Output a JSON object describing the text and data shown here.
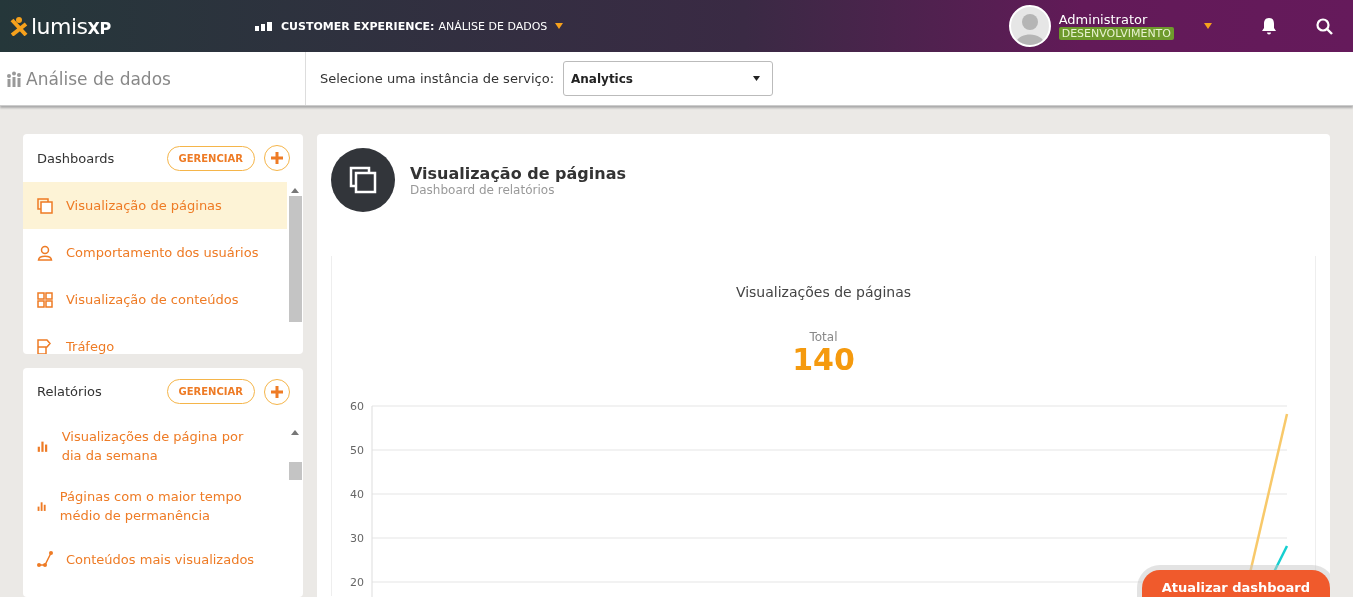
{
  "header": {
    "logo": {
      "main": "lumis",
      "suffix": "XP"
    },
    "context": "CUSTOMER EXPERIENCE:",
    "context_detail": "ANÁLISE DE DADOS",
    "user": {
      "name": "Administrator",
      "environment": "DESENVOLVIMENTO"
    }
  },
  "subheader": {
    "title": "Análise de dados",
    "select_label": "Selecione uma instância de serviço:",
    "select_value": "Analytics"
  },
  "panels": [
    {
      "title": "Dashboards",
      "manage": "GERENCIAR",
      "items": [
        {
          "label": "Visualização de páginas",
          "kind": "pages",
          "selected": true
        },
        {
          "label": "Comportamento dos usuários",
          "kind": "user",
          "selected": false
        },
        {
          "label": "Visualização de conteúdos",
          "kind": "grid",
          "selected": false
        },
        {
          "label": "Tráfego",
          "kind": "traffic",
          "selected": false
        }
      ]
    },
    {
      "title": "Relatórios",
      "manage": "GERENCIAR",
      "items": [
        {
          "label": "Visualizações de página por dia da semana",
          "kind": "bars",
          "selected": false
        },
        {
          "label": "Páginas com o maior tempo médio de permanência",
          "kind": "bars",
          "selected": false
        },
        {
          "label": "Conteúdos mais visualizados",
          "kind": "scatter",
          "selected": false
        }
      ]
    }
  ],
  "dashboard": {
    "title": "Visualização de páginas",
    "subtitle": "Dashboard de relatórios",
    "chart_title": "Visualizações de páginas",
    "total_label": "Total",
    "total_value": "140",
    "y_axis_ticks": [
      "60",
      "50",
      "40",
      "30",
      "20"
    ],
    "refresh_button": "Atualizar dashboard"
  }
}
